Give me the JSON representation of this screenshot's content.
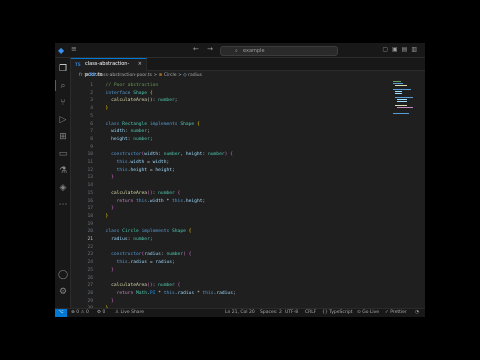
{
  "titlebar": {
    "search_text": "example",
    "logo_icon": "vscode-logo-icon"
  },
  "tab": {
    "badge": "TS",
    "filename": "class-abstraction-poor.ts",
    "close": "×"
  },
  "breadcrumb": {
    "folder": "fr",
    "file": "class-abstraction-poor.ts",
    "sep1": ">",
    "symbol": "Circle",
    "sep2": ">",
    "member": "radius"
  },
  "editor": {
    "current_line": 21,
    "lines": [
      {
        "n": "1",
        "tokens": [
          [
            "  ",
            "w"
          ],
          [
            "// Poor abstraction",
            "c"
          ]
        ]
      },
      {
        "n": "2",
        "tokens": [
          [
            "  ",
            "w"
          ],
          [
            "interface",
            "k"
          ],
          [
            " ",
            "w"
          ],
          [
            "Shape",
            "t"
          ],
          [
            " ",
            "w"
          ],
          [
            "{",
            "y"
          ]
        ]
      },
      {
        "n": "3",
        "tokens": [
          [
            "    ",
            "w"
          ],
          [
            "calculateArea",
            "f"
          ],
          [
            "(): ",
            "w"
          ],
          [
            "number",
            "t"
          ],
          [
            ";",
            "w"
          ]
        ]
      },
      {
        "n": "4",
        "tokens": [
          [
            "  ",
            "w"
          ],
          [
            "}",
            "y"
          ]
        ]
      },
      {
        "n": "5",
        "tokens": []
      },
      {
        "n": "6",
        "tokens": [
          [
            "  ",
            "w"
          ],
          [
            "class",
            "k"
          ],
          [
            " ",
            "w"
          ],
          [
            "Rectangle",
            "t"
          ],
          [
            " ",
            "w"
          ],
          [
            "implements",
            "k"
          ],
          [
            " ",
            "w"
          ],
          [
            "Shape",
            "t"
          ],
          [
            " ",
            "w"
          ],
          [
            "{",
            "y"
          ]
        ]
      },
      {
        "n": "7",
        "tokens": [
          [
            "    ",
            "w"
          ],
          [
            "width",
            "p"
          ],
          [
            ": ",
            "w"
          ],
          [
            "number",
            "t"
          ],
          [
            ";",
            "w"
          ]
        ]
      },
      {
        "n": "8",
        "tokens": [
          [
            "    ",
            "w"
          ],
          [
            "height",
            "p"
          ],
          [
            ": ",
            "w"
          ],
          [
            "number",
            "t"
          ],
          [
            ";",
            "w"
          ]
        ]
      },
      {
        "n": "9",
        "tokens": []
      },
      {
        "n": "10",
        "tokens": [
          [
            "    ",
            "w"
          ],
          [
            "constructor",
            "k"
          ],
          [
            "(",
            "o"
          ],
          [
            "width",
            "p"
          ],
          [
            ": ",
            "w"
          ],
          [
            "number",
            "t"
          ],
          [
            ", ",
            "w"
          ],
          [
            "height",
            "p"
          ],
          [
            ": ",
            "w"
          ],
          [
            "number",
            "t"
          ],
          [
            ")",
            "o"
          ],
          [
            " ",
            "w"
          ],
          [
            "{",
            "o"
          ]
        ]
      },
      {
        "n": "11",
        "tokens": [
          [
            "      ",
            "w"
          ],
          [
            "this",
            "k"
          ],
          [
            ".",
            "w"
          ],
          [
            "width",
            "p"
          ],
          [
            " = ",
            "w"
          ],
          [
            "width",
            "p"
          ],
          [
            ";",
            "w"
          ]
        ]
      },
      {
        "n": "12",
        "tokens": [
          [
            "      ",
            "w"
          ],
          [
            "this",
            "k"
          ],
          [
            ".",
            "w"
          ],
          [
            "height",
            "p"
          ],
          [
            " = ",
            "w"
          ],
          [
            "height",
            "p"
          ],
          [
            ";",
            "w"
          ]
        ]
      },
      {
        "n": "13",
        "tokens": [
          [
            "    ",
            "w"
          ],
          [
            "}",
            "o"
          ]
        ]
      },
      {
        "n": "14",
        "tokens": []
      },
      {
        "n": "15",
        "tokens": [
          [
            "    ",
            "w"
          ],
          [
            "calculateArea",
            "f"
          ],
          [
            "(",
            "o"
          ],
          [
            ")",
            "o"
          ],
          [
            ": ",
            "w"
          ],
          [
            "number",
            "t"
          ],
          [
            " ",
            "w"
          ],
          [
            "{",
            "o"
          ]
        ]
      },
      {
        "n": "16",
        "tokens": [
          [
            "      ",
            "w"
          ],
          [
            "return",
            "k2"
          ],
          [
            " ",
            "w"
          ],
          [
            "this",
            "k"
          ],
          [
            ".",
            "w"
          ],
          [
            "width",
            "p"
          ],
          [
            " * ",
            "w"
          ],
          [
            "this",
            "k"
          ],
          [
            ".",
            "w"
          ],
          [
            "height",
            "p"
          ],
          [
            ";",
            "w"
          ]
        ]
      },
      {
        "n": "17",
        "tokens": [
          [
            "    ",
            "w"
          ],
          [
            "}",
            "o"
          ]
        ]
      },
      {
        "n": "18",
        "tokens": [
          [
            "  ",
            "w"
          ],
          [
            "}",
            "y"
          ]
        ]
      },
      {
        "n": "19",
        "tokens": []
      },
      {
        "n": "20",
        "tokens": [
          [
            "  ",
            "w"
          ],
          [
            "class",
            "k"
          ],
          [
            " ",
            "w"
          ],
          [
            "Circle",
            "t"
          ],
          [
            " ",
            "w"
          ],
          [
            "implements",
            "k"
          ],
          [
            " ",
            "w"
          ],
          [
            "Shape",
            "t"
          ],
          [
            " ",
            "w"
          ],
          [
            "{",
            "y"
          ]
        ]
      },
      {
        "n": "21",
        "tokens": [
          [
            "    ",
            "w"
          ],
          [
            "radius",
            "p"
          ],
          [
            ": ",
            "w"
          ],
          [
            "number",
            "t"
          ],
          [
            ";",
            "w"
          ]
        ]
      },
      {
        "n": "22",
        "tokens": []
      },
      {
        "n": "23",
        "tokens": [
          [
            "    ",
            "w"
          ],
          [
            "constructor",
            "k"
          ],
          [
            "(",
            "o"
          ],
          [
            "radius",
            "p"
          ],
          [
            ": ",
            "w"
          ],
          [
            "number",
            "t"
          ],
          [
            ")",
            "o"
          ],
          [
            " ",
            "w"
          ],
          [
            "{",
            "o"
          ]
        ]
      },
      {
        "n": "24",
        "tokens": [
          [
            "      ",
            "w"
          ],
          [
            "this",
            "k"
          ],
          [
            ".",
            "w"
          ],
          [
            "radius",
            "p"
          ],
          [
            " = ",
            "w"
          ],
          [
            "radius",
            "p"
          ],
          [
            ";",
            "w"
          ]
        ]
      },
      {
        "n": "25",
        "tokens": [
          [
            "    ",
            "w"
          ],
          [
            "}",
            "o"
          ]
        ]
      },
      {
        "n": "26",
        "tokens": []
      },
      {
        "n": "27",
        "tokens": [
          [
            "    ",
            "w"
          ],
          [
            "calculateArea",
            "f"
          ],
          [
            "(",
            "o"
          ],
          [
            ")",
            "o"
          ],
          [
            ": ",
            "w"
          ],
          [
            "number",
            "t"
          ],
          [
            " ",
            "w"
          ],
          [
            "{",
            "o"
          ]
        ]
      },
      {
        "n": "28",
        "tokens": [
          [
            "      ",
            "w"
          ],
          [
            "return",
            "k2"
          ],
          [
            " ",
            "w"
          ],
          [
            "Math",
            "t"
          ],
          [
            ".",
            "w"
          ],
          [
            "PI",
            "b"
          ],
          [
            " * ",
            "w"
          ],
          [
            "this",
            "k"
          ],
          [
            ".",
            "w"
          ],
          [
            "radius",
            "p"
          ],
          [
            " * ",
            "w"
          ],
          [
            "this",
            "k"
          ],
          [
            ".",
            "w"
          ],
          [
            "radius",
            "p"
          ],
          [
            ";",
            "w"
          ]
        ]
      },
      {
        "n": "29",
        "tokens": [
          [
            "    ",
            "w"
          ],
          [
            "}",
            "o"
          ]
        ]
      },
      {
        "n": "30",
        "tokens": [
          [
            "  ",
            "w"
          ],
          [
            "}",
            "y"
          ]
        ]
      }
    ]
  },
  "statusbar": {
    "remote": "⌥",
    "errors": "⊗ 0 ⚠ 0",
    "ports": "⚙ 0",
    "live_share": "♙ Live Share",
    "position": "Ln 21, Col 20",
    "spaces": "Spaces: 2",
    "encoding": "UTF-8",
    "eol": "CRLF",
    "language": "{} TypeScript",
    "go_live": "⊙ Go Live",
    "prettier": "✓ Prettier",
    "bell": "🔔"
  },
  "colors": {
    "accent": "#0078d4",
    "editor_bg": "#1f1f1f",
    "chrome_bg": "#181818"
  },
  "activity_icons": [
    "files-icon",
    "search-icon",
    "source-control-icon",
    "run-debug-icon",
    "extensions-icon",
    "remote-explorer-icon",
    "testing-icon",
    "docker-icon",
    "more-icon",
    "account-icon",
    "settings-gear-icon"
  ]
}
